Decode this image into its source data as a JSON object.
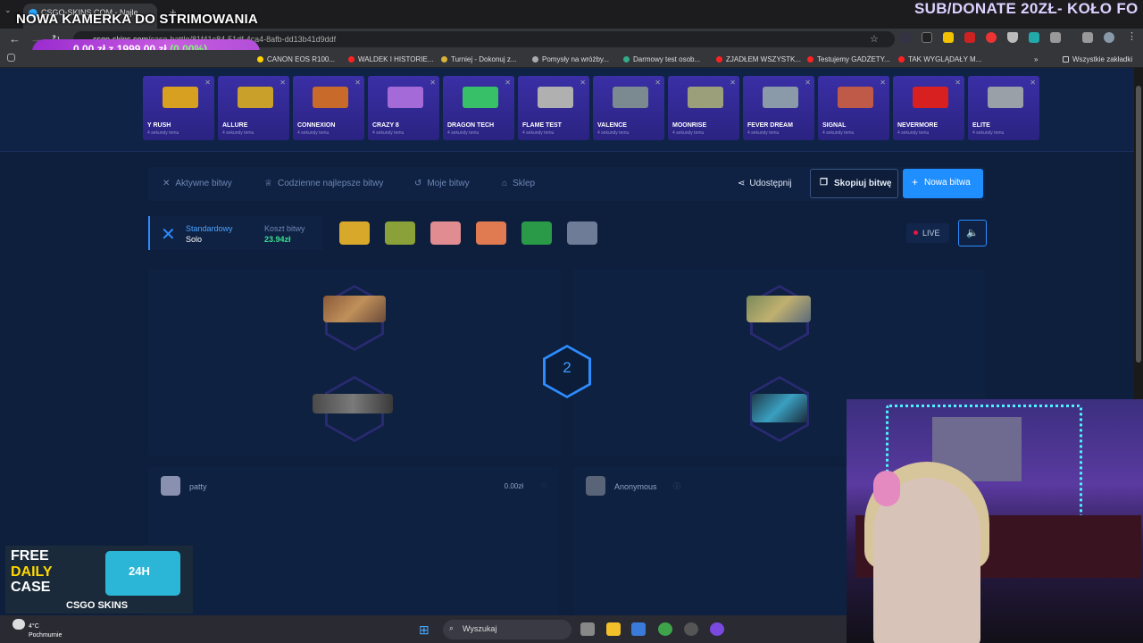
{
  "browser": {
    "tab_title": "CSGO-SKINS.COM - Najle",
    "url_host": "csgo-skins.com",
    "url_path": "/case-battle/81f41c84-51df-4ca4-8afb-dd13b41d9ddf",
    "bookmarks": [
      "CANON EOS R100...",
      "WALDEK I HISTORIE...",
      "Turniej - Dokonuj z...",
      "Pomysły na wróżby...",
      "Darmowy test osob...",
      "ZJADŁEM WSZYSTK...",
      "Testujemy GADŻETY...",
      "TAK WYGLĄDAŁY M...",
      "Wszystkie zakładki"
    ]
  },
  "overlay": {
    "stream_title": "NOWA KAMERKA DO STRIMOWANIA",
    "donate_banner": "SUB/DONATE 20ZŁ- KOŁO FO",
    "goal_current": "0,00 zł",
    "goal_sep": "z",
    "goal_target": "1999,00 zł",
    "goal_percent": "(0.00%)"
  },
  "carousel": {
    "subtitle": "4 sekundy temu",
    "cases": [
      {
        "name": "Y RUSH",
        "color": "#d8a020"
      },
      {
        "name": "ALLURE",
        "color": "#c9a02a"
      },
      {
        "name": "CONNEXION",
        "color": "#c86a2a"
      },
      {
        "name": "CRAZY 8",
        "color": "#a36ad8"
      },
      {
        "name": "DRAGON TECH",
        "color": "#38c068"
      },
      {
        "name": "FLAME TEST",
        "color": "#b0b0b0"
      },
      {
        "name": "VALENCE",
        "color": "#7a8a90"
      },
      {
        "name": "MOONRISE",
        "color": "#9ca07a"
      },
      {
        "name": "FEVER DREAM",
        "color": "#8a9aa8"
      },
      {
        "name": "SIGNAL",
        "color": "#c05a48"
      },
      {
        "name": "NEVERMORE",
        "color": "#d82020"
      },
      {
        "name": "ELITE",
        "color": "#9aa0a8"
      }
    ]
  },
  "toolbar": {
    "active": "Aktywne bitwy",
    "daily_best": "Codzienne najlepsze bitwy",
    "my_battles": "Moje bitwy",
    "shop": "Sklep",
    "share": "Udostępnij",
    "copy_battle": "Skopiuj bitwę",
    "new_battle": "Nowa bitwa"
  },
  "battle": {
    "mode_type": "Standardowy",
    "mode_sub": "Solo",
    "cost_label": "Koszt bitwy",
    "cost_value": "23.94zł",
    "live_label": "LIVE",
    "round": "2",
    "crate_colors": [
      "#d8a82a",
      "#8aa038",
      "#e08c90",
      "#e07a50",
      "#2a9a48",
      "#6f7c98"
    ]
  },
  "players": [
    {
      "name": "patty",
      "value": "0.00zł"
    },
    {
      "name": "Anonymous"
    }
  ],
  "promo": {
    "line1": "FREE",
    "line2": "DAILY",
    "line3": "CASE",
    "brand": "CSGO SKINS",
    "badge": "24H"
  },
  "taskbar": {
    "temp": "4°C",
    "weather": "Pochmurnie",
    "search": "Wyszukaj"
  }
}
